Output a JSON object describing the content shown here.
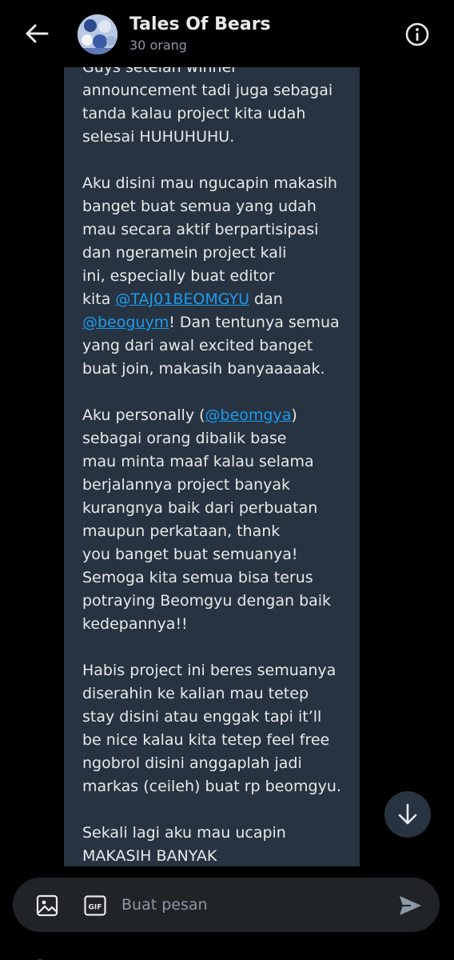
{
  "header": {
    "back_icon": "arrow-left-icon",
    "title": "Tales Of Bears",
    "subtitle": "30 orang",
    "info_icon": "info-circle-icon"
  },
  "message": {
    "p1": {
      "l1": "Guys setelah winner",
      "l2": "announcement tadi juga sebagai",
      "l3": "tanda kalau project kita udah",
      "l4": "selesai HUHUHUHU."
    },
    "p2": {
      "l1": "Aku disini mau ngucapin makasih",
      "l2": "banget buat semua yang udah",
      "l3": "mau secara aktif berpartisipasi",
      "l4": "dan ngeramein project kali",
      "l5": "ini, especially buat editor",
      "l6_a": "kita ",
      "l6_m": "@TAJ01BEOMGYU",
      "l6_b": " dan",
      "l7_m": "@beoguym",
      "l7_b": "! Dan tentunya semua",
      "l8": "yang dari awal excited banget",
      "l9": "buat join, makasih banyaaaaak."
    },
    "p3": {
      "l1_a": "Aku personally (",
      "l1_m": "@beomgya",
      "l1_b": ")",
      "l2": "sebagai orang dibalik base",
      "l3": "mau minta maaf kalau selama",
      "l4": "berjalannya project banyak",
      "l5": "kurangnya baik dari perbuatan",
      "l6": "maupun perkataan, thank",
      "l7": "you banget buat semuanya!",
      "l8": "Semoga kita semua bisa terus",
      "l9": "potraying Beomgyu dengan baik",
      "l10": "kedepannya!!"
    },
    "p4": {
      "l1": "Habis project ini beres semuanya",
      "l2": "diserahin ke kalian mau tetep",
      "l3": "stay disini atau enggak tapi it’ll",
      "l4": "be nice kalau kita tetep feel free",
      "l5": "ngobrol disini anggaplah jadi",
      "l6": "markas (ceileh) buat rp beomgyu."
    },
    "p5": {
      "l1": "Sekali lagi aku mau ucapin",
      "l2": "MAKASIH BANYAK"
    }
  },
  "scroll_down_icon": "arrow-down-icon",
  "composer": {
    "image_icon": "image-icon",
    "gif_icon": "gif-icon",
    "gif_label": "GIF",
    "placeholder": "Buat pesan",
    "send_icon": "send-icon"
  },
  "colors": {
    "background": "#000000",
    "bubble": "#273340",
    "text": "#e7e9ea",
    "muted": "#8b98a5",
    "mention": "#1d9bf0",
    "composer": "#202327"
  }
}
